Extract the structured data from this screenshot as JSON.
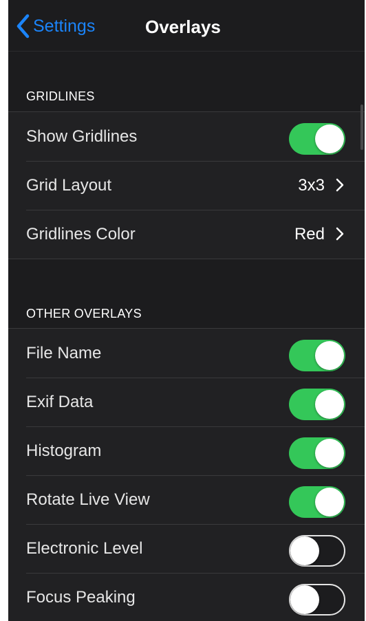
{
  "navbar": {
    "back_label": "Settings",
    "title": "Overlays",
    "accent_color": "#1b84f9"
  },
  "sections": [
    {
      "header": "GRIDLINES",
      "rows": [
        {
          "label": "Show Gridlines",
          "control": "toggle",
          "on": true
        },
        {
          "label": "Grid Layout",
          "control": "disclosure",
          "value": "3x3"
        },
        {
          "label": "Gridlines Color",
          "control": "disclosure",
          "value": "Red"
        }
      ]
    },
    {
      "header": "OTHER OVERLAYS",
      "rows": [
        {
          "label": "File Name",
          "control": "toggle",
          "on": true
        },
        {
          "label": "Exif Data",
          "control": "toggle",
          "on": true
        },
        {
          "label": "Histogram",
          "control": "toggle",
          "on": true
        },
        {
          "label": "Rotate Live View",
          "control": "toggle",
          "on": true
        },
        {
          "label": "Electronic Level",
          "control": "toggle",
          "on": false
        },
        {
          "label": "Focus Peaking",
          "control": "toggle",
          "on": false
        }
      ]
    }
  ],
  "colors": {
    "toggle_on": "#34c759",
    "background": "#1c1c1e"
  },
  "icons": {
    "back": "chevron-left-icon",
    "disclosure": "chevron-right-icon"
  }
}
